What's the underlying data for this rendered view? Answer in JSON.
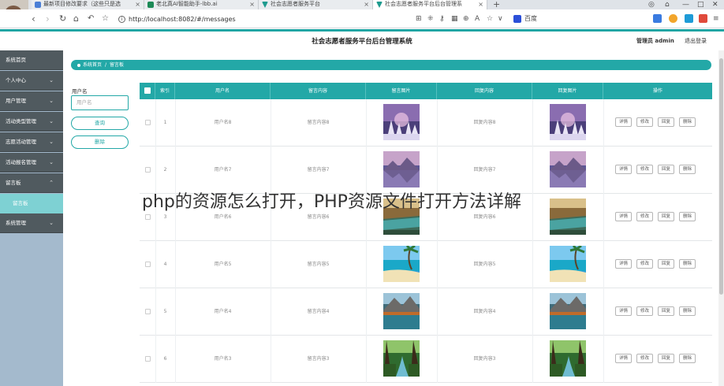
{
  "browser": {
    "tabs": [
      {
        "title": "最新项目修改要求（这些只是选",
        "icon_color": "#4a7fd6",
        "active": false
      },
      {
        "title": "老北真AI智能助手-lbb.ai",
        "icon_color": "#1d8a57",
        "active": false
      },
      {
        "title": "社会志愿者服务平台",
        "icon_color": "#1e9b8f",
        "active": false
      },
      {
        "title": "社会志愿者服务平台后台管理系",
        "icon_color": "#1e9b8f",
        "active": true
      }
    ],
    "new_tab": "+",
    "url": "http://localhost:8082/#/messages",
    "search_engine": "百度"
  },
  "header": {
    "title": "社会志愿者服务平台后台管理系统",
    "user": "管理员 admin",
    "logout": "退出登录"
  },
  "sidebar": {
    "items": [
      {
        "label": "系统首页",
        "chevron": false
      },
      {
        "label": "个人中心",
        "chevron": true
      },
      {
        "label": "用户管理",
        "chevron": true
      },
      {
        "label": "活动类型管理",
        "chevron": true
      },
      {
        "label": "志愿活动管理",
        "chevron": true
      },
      {
        "label": "活动报名管理",
        "chevron": true
      },
      {
        "label": "留言板",
        "chevron": true,
        "expanded": true
      },
      {
        "label": "系统管理",
        "chevron": true
      }
    ],
    "subitem": "留言板"
  },
  "breadcrumb": {
    "home": "系统首页",
    "sep": "/",
    "current": "留言板"
  },
  "filter": {
    "label": "用户名",
    "placeholder": "用户名",
    "search_button": "查询",
    "delete_button": "删除"
  },
  "table": {
    "headers": [
      "索引",
      "用户名",
      "留言内容",
      "留言图片",
      "回复内容",
      "回复图片",
      "操作"
    ],
    "actions": [
      "详情",
      "修改",
      "回复",
      "删除"
    ],
    "rows": [
      {
        "index": "1",
        "user": "用户名8",
        "content": "留言内容8",
        "reply": "回复内容8",
        "image": "winter-forest"
      },
      {
        "index": "2",
        "user": "用户名7",
        "content": "留言内容7",
        "reply": "回复内容7",
        "image": "mountain-lake"
      },
      {
        "index": "3",
        "user": "用户名6",
        "content": "留言内容6",
        "reply": "回复内容6",
        "image": "canyon-river"
      },
      {
        "index": "4",
        "user": "用户名5",
        "content": "留言内容5",
        "reply": "回复内容5",
        "image": "tropical-beach"
      },
      {
        "index": "5",
        "user": "用户名4",
        "content": "留言内容4",
        "reply": "回复内容4",
        "image": "mountain-lake-autumn"
      },
      {
        "index": "6",
        "user": "用户名3",
        "content": "留言内容3",
        "reply": "回复内容3",
        "image": "forest-stream"
      }
    ]
  },
  "watermark": "php的资源怎么打开，PHP资源文件打开方法详解",
  "colors": {
    "accent": "#23a8a7",
    "sidebar_dark": "#505a5f",
    "sidebar_bg": "#a4bacd",
    "sidebar_sub": "#7ed1d3"
  }
}
